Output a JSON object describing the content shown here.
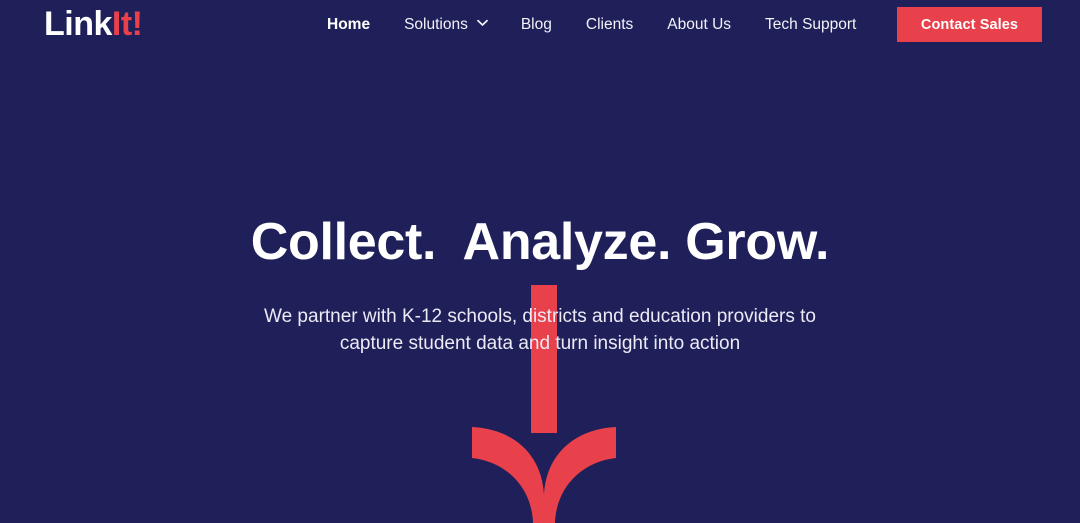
{
  "theme": {
    "background": "#1f2059",
    "accent_red": "#e8414c",
    "text_white": "#ffffff",
    "text_muted": "#eceaf5"
  },
  "header": {
    "logo": {
      "part_one": "Link",
      "part_two": "It!",
      "icon_name": "linkit-logo"
    },
    "nav": [
      {
        "label": "Home",
        "active": true,
        "has_dropdown": false
      },
      {
        "label": "Solutions",
        "active": false,
        "has_dropdown": true,
        "dropdown_icon": "chevron-down-icon"
      },
      {
        "label": "Blog",
        "active": false,
        "has_dropdown": false
      },
      {
        "label": "Clients",
        "active": false,
        "has_dropdown": false
      },
      {
        "label": "About Us",
        "active": false,
        "has_dropdown": false
      },
      {
        "label": "Tech Support",
        "active": false,
        "has_dropdown": false
      }
    ],
    "cta": {
      "label": "Contact Sales"
    }
  },
  "hero": {
    "title": "Collect.  Analyze. Grow.",
    "subtitle": "We partner with K-12 schools, districts and education providers to\ncapture student data and turn insight into action",
    "graphic": {
      "icon_name": "down-arrow-funnel-graphic",
      "color": "#e8414c"
    }
  }
}
